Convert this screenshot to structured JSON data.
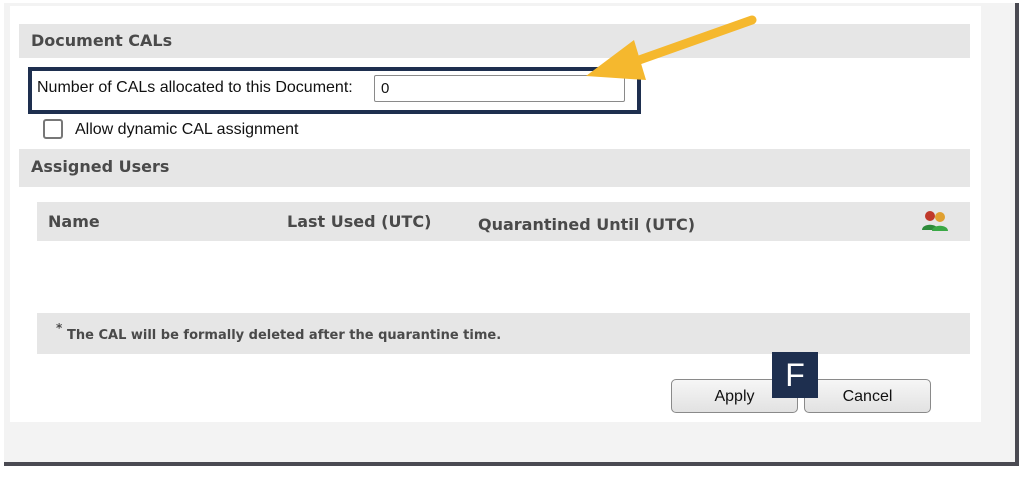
{
  "document_cals": {
    "header": "Document CALs",
    "allocated_label": "Number of CALs allocated to this Document:",
    "allocated_value": "0",
    "dynamic_label": "Allow dynamic CAL assignment",
    "dynamic_checked": false
  },
  "assigned_users": {
    "header": "Assigned Users",
    "columns": [
      "Name",
      "Last Used (UTC)",
      "Quarantined Until (UTC)"
    ],
    "icon": "users-icon",
    "rows": []
  },
  "footnote": {
    "star": "*",
    "text": "The CAL will be formally deleted after the quarantine time."
  },
  "buttons": {
    "apply": "Apply",
    "cancel": "Cancel"
  },
  "callout": {
    "badge": "F",
    "arrow_color": "#f5b82e",
    "highlight_color": "#1e2f4f"
  }
}
